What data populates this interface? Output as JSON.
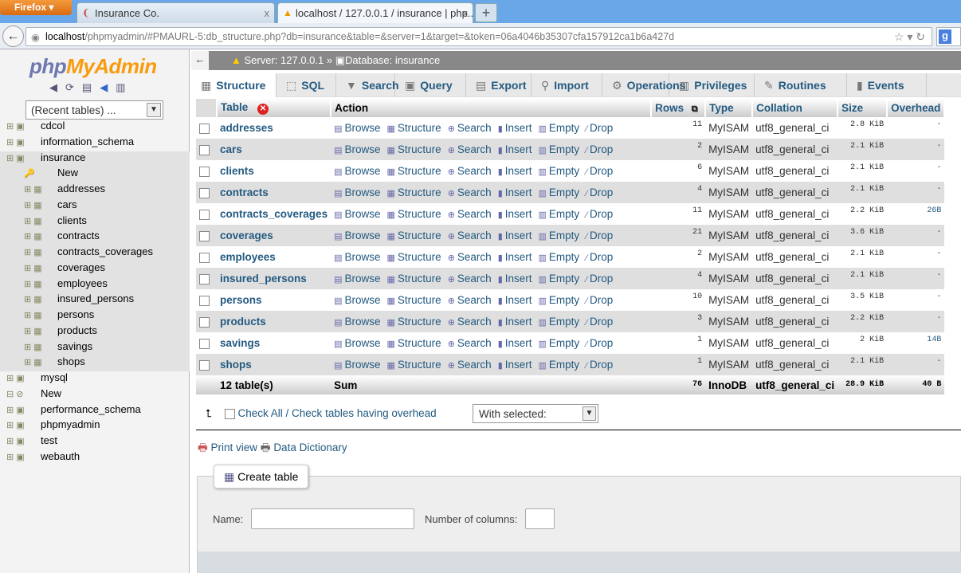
{
  "browser": {
    "menu_label": "Firefox",
    "tabs": [
      {
        "title": "Insurance Co."
      },
      {
        "title": "localhost / 127.0.0.1 / insurance | php..."
      }
    ],
    "url_host": "localhost",
    "url_path": "/phpmyadmin/#PMAURL-5:db_structure.php?db=insurance&table=&server=1&target=&token=06a4046b35307cfa157912ca1b6a427d"
  },
  "sidebar": {
    "logo_php": "php",
    "logo_myadmin": "MyAdmin",
    "recent_tables": "(Recent tables) ...",
    "databases": [
      {
        "name": "cdcol"
      },
      {
        "name": "information_schema"
      },
      {
        "name": "insurance"
      }
    ],
    "insurance_children": [
      "New",
      "addresses",
      "cars",
      "clients",
      "contracts",
      "contracts_coverages",
      "coverages",
      "employees",
      "insured_persons",
      "persons",
      "products",
      "savings",
      "shops"
    ],
    "more_databases": [
      "mysql",
      "New",
      "performance_schema",
      "phpmyadmin",
      "test",
      "webauth"
    ]
  },
  "breadcrumb": {
    "server": "Server: 127.0.0.1",
    "sep": "»",
    "database": "Database: insurance"
  },
  "menu": [
    "Structure",
    "SQL",
    "Search",
    "Query",
    "Export",
    "Import",
    "Operations",
    "Privileges",
    "Routines",
    "Events"
  ],
  "table": {
    "headers": {
      "table": "Table",
      "action": "Action",
      "rows": "Rows",
      "type": "Type",
      "collation": "Collation",
      "size": "Size",
      "overhead": "Overhead"
    },
    "actions": [
      "Browse",
      "Structure",
      "Search",
      "Insert",
      "Empty",
      "Drop"
    ],
    "rows": [
      {
        "name": "addresses",
        "rows": "11",
        "type": "MyISAM",
        "collation": "utf8_general_ci",
        "size": "2.8 KiB",
        "overhead": "-"
      },
      {
        "name": "cars",
        "rows": "2",
        "type": "MyISAM",
        "collation": "utf8_general_ci",
        "size": "2.1 KiB",
        "overhead": "-"
      },
      {
        "name": "clients",
        "rows": "6",
        "type": "MyISAM",
        "collation": "utf8_general_ci",
        "size": "2.1 KiB",
        "overhead": "-"
      },
      {
        "name": "contracts",
        "rows": "4",
        "type": "MyISAM",
        "collation": "utf8_general_ci",
        "size": "2.1 KiB",
        "overhead": "-"
      },
      {
        "name": "contracts_coverages",
        "rows": "11",
        "type": "MyISAM",
        "collation": "utf8_general_ci",
        "size": "2.2 KiB",
        "overhead": "26B"
      },
      {
        "name": "coverages",
        "rows": "21",
        "type": "MyISAM",
        "collation": "utf8_general_ci",
        "size": "3.6 KiB",
        "overhead": "-"
      },
      {
        "name": "employees",
        "rows": "2",
        "type": "MyISAM",
        "collation": "utf8_general_ci",
        "size": "2.1 KiB",
        "overhead": "-"
      },
      {
        "name": "insured_persons",
        "rows": "4",
        "type": "MyISAM",
        "collation": "utf8_general_ci",
        "size": "2.1 KiB",
        "overhead": "-"
      },
      {
        "name": "persons",
        "rows": "10",
        "type": "MyISAM",
        "collation": "utf8_general_ci",
        "size": "3.5 KiB",
        "overhead": "-"
      },
      {
        "name": "products",
        "rows": "3",
        "type": "MyISAM",
        "collation": "utf8_general_ci",
        "size": "2.2 KiB",
        "overhead": "-"
      },
      {
        "name": "savings",
        "rows": "1",
        "type": "MyISAM",
        "collation": "utf8_general_ci",
        "size": "2 KiB",
        "overhead": "14B"
      },
      {
        "name": "shops",
        "rows": "1",
        "type": "MyISAM",
        "collation": "utf8_general_ci",
        "size": "2.1 KiB",
        "overhead": "-"
      }
    ],
    "summary": {
      "count": "12 table(s)",
      "label": "Sum",
      "rows": "76",
      "type": "InnoDB",
      "collation": "utf8_general_ci",
      "size": "28.9 KiB",
      "overhead": "40 B"
    }
  },
  "bulk": {
    "check_all": "Check All",
    "sep": " / ",
    "check_overhead": "Check tables having overhead",
    "with_selected": "With selected:"
  },
  "links": {
    "print_view": "Print view",
    "data_dictionary": "Data Dictionary"
  },
  "create_table": {
    "legend": "Create table",
    "name_label": "Name:",
    "columns_label": "Number of columns:",
    "name_value": "",
    "columns_value": ""
  }
}
